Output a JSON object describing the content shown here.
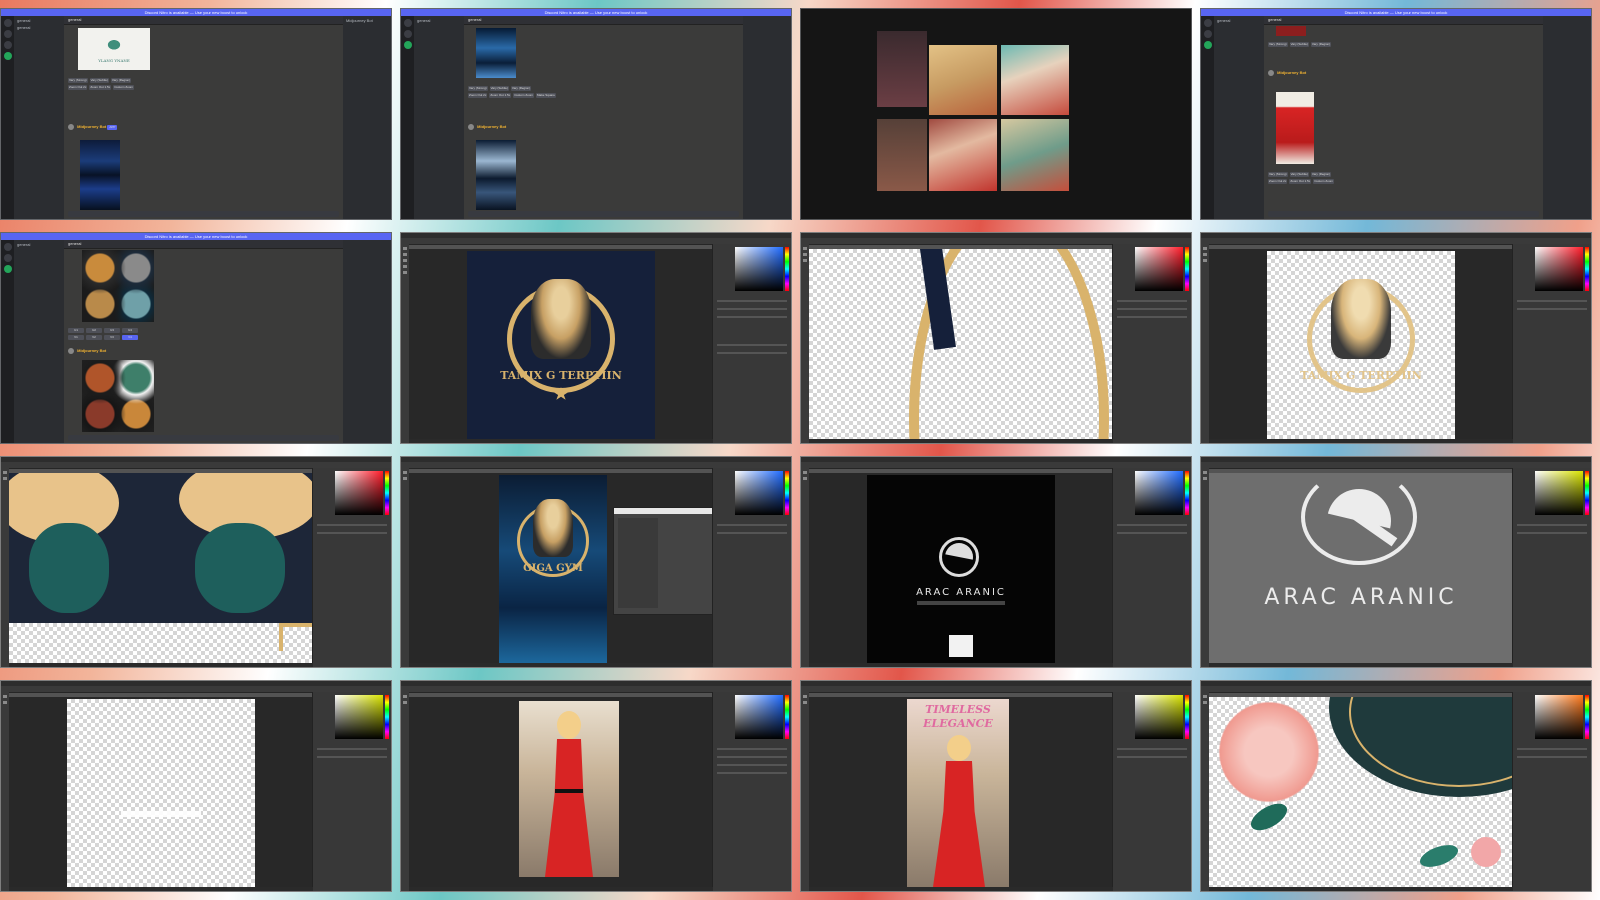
{
  "discord": {
    "top_banner": "Discord Nitro is available — Use your new boost to unlock",
    "banner_button": "Unlock",
    "server_name": "general",
    "channel_header": "general",
    "bot_name": "Midjourney Bot",
    "tag": "APP",
    "buttons": [
      "U1",
      "U2",
      "U3",
      "U4",
      "V1",
      "V2",
      "V3",
      "V4"
    ],
    "button_labels": [
      "Vary (Strong)",
      "Vary (Subtle)",
      "Vary (Region)",
      "Zoom Out 2x",
      "Zoom Out 1.5x",
      "Custom Zoom",
      "Make Square"
    ]
  },
  "photoshop": {
    "logo_gym_old": "TAMIX G TERPTIIN",
    "logo_gym_new": "GIGA GYM",
    "logo_arac": "ARAC ARANIC",
    "poster_text_line1": "TIMELESS",
    "poster_text_line2": "ELEGANCE"
  },
  "colors": {
    "discord_bg": "#313338",
    "discord_accent": "#5865f2",
    "ps_bg": "#535353",
    "gold": "#d9b36c",
    "navy": "#15203a",
    "red_dress": "#d82424"
  },
  "icons": [
    "discord-server-icon",
    "ps-tool-icon",
    "hue-slider",
    "color-picker"
  ]
}
